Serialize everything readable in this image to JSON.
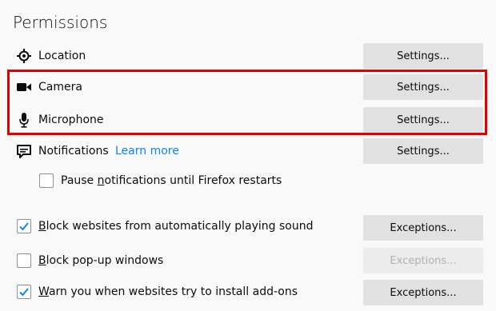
{
  "section": {
    "title": "Permissions"
  },
  "permissions": [
    {
      "icon": "location-icon",
      "label": "Location",
      "button": "Settings..."
    },
    {
      "icon": "camera-icon",
      "label": "Camera",
      "button": "Settings..."
    },
    {
      "icon": "microphone-icon",
      "label": "Microphone",
      "button": "Settings..."
    },
    {
      "icon": "notifications-icon",
      "label": "Notifications",
      "link": "Learn more",
      "button": "Settings..."
    }
  ],
  "pause_notifications": {
    "checked": false,
    "label_pre": "Pause ",
    "label_mn": "n",
    "label_post": "otifications until Firefox restarts"
  },
  "options": [
    {
      "checked": true,
      "label_mn": "B",
      "label_post": "lock websites from automatically playing sound",
      "button": "Exceptions...",
      "button_disabled": false
    },
    {
      "checked": false,
      "label_mn": "B",
      "label_post": "lock pop-up windows",
      "button": "Exceptions...",
      "button_disabled": true
    },
    {
      "checked": true,
      "label_mn": "W",
      "label_post": "arn you when websites try to install add-ons",
      "button": "Exceptions...",
      "button_disabled": false
    }
  ],
  "colors": {
    "accent": "#0a84ff",
    "highlight": "#e40000",
    "checkmark": "#0a84ff"
  }
}
